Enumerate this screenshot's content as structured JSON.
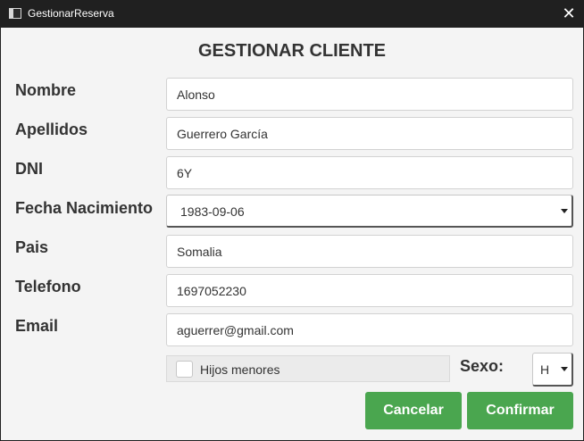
{
  "window": {
    "title": "GestionarReserva",
    "close_glyph": "✕"
  },
  "form": {
    "heading": "GESTIONAR CLIENTE",
    "fields": {
      "nombre": {
        "label": "Nombre",
        "value": "Alonso"
      },
      "apellidos": {
        "label": "Apellidos",
        "value": "Guerrero García"
      },
      "dni": {
        "label": "DNI",
        "value": "6Y"
      },
      "fecha_nacimiento": {
        "label": "Fecha Nacimiento",
        "value": "1983-09-06"
      },
      "pais": {
        "label": "Pais",
        "value": "Somalia"
      },
      "telefono": {
        "label": "Telefono",
        "value": "1697052230"
      },
      "email": {
        "label": "Email",
        "value": "aguerrer@gmail.com"
      }
    },
    "hijos_menores": {
      "label": "Hijos menores",
      "checked": false
    },
    "sexo": {
      "label": "Sexo:",
      "value": "H"
    },
    "buttons": {
      "cancel": "Cancelar",
      "confirm": "Confirmar"
    }
  },
  "colors": {
    "accent_button": "#4aa64f",
    "titlebar": "#202020",
    "background": "#f4f4f4"
  }
}
